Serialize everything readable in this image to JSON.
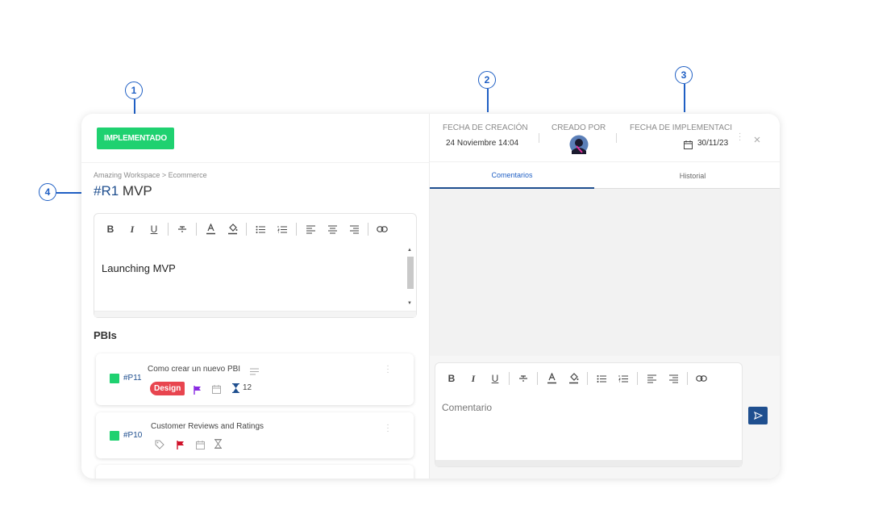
{
  "callouts": [
    "1",
    "2",
    "3",
    "4"
  ],
  "status": {
    "label": "IMPLEMENTADO",
    "color": "#1fd170"
  },
  "breadcrumb": "Amazing Workspace > Ecommerce",
  "item": {
    "id": "#R1",
    "name": "MVP"
  },
  "editor": {
    "toolbar": [
      "B",
      "I",
      "U",
      "strikethrough",
      "text-color",
      "highlight",
      "bullet-list",
      "numbered-list",
      "align-left",
      "align-center",
      "align-right",
      "link"
    ],
    "content": "Launching MVP"
  },
  "pbis": {
    "heading": "PBIs",
    "items": [
      {
        "id": "#P11",
        "title": "Como crear un nuevo PBI",
        "tag": "Design",
        "estimate": "12"
      },
      {
        "id": "#P10",
        "title": "Customer Reviews and Ratings",
        "tag": "",
        "estimate": ""
      }
    ]
  },
  "meta": {
    "created_label": "FECHA DE CREACIÓN",
    "created_value": "24 Noviembre 14:04",
    "created_by_label": "CREADO POR",
    "implemented_label": "FECHA DE IMPLEMENTACI",
    "implemented_value": "30/11/23"
  },
  "tabs": [
    "Comentarios",
    "Historial"
  ],
  "composer": {
    "placeholder": "Comentario"
  },
  "colors": {
    "accent": "#1f4f8f",
    "green": "#1fd170",
    "design_tag": "#e8454f"
  }
}
